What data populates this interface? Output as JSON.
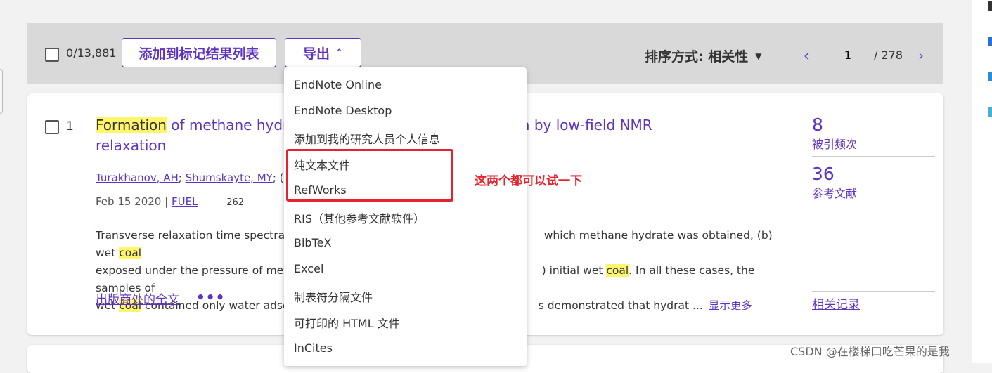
{
  "toolbar": {
    "selected_count": "0/13,881",
    "add_to_marked_label": "添加到标记结果列表",
    "export_label": "导出",
    "sort_label": "排序方式: 相关性",
    "page_current": "1",
    "page_total": "/ 278"
  },
  "result": {
    "number": "1",
    "title_highlight": "Formation",
    "title_part1": " of methane hydra",
    "title_part2": "n investgation by low-field NMR",
    "title_line2": "relaxation",
    "author1": "Turakhanov, AH",
    "author_sep": "; ",
    "author2": "Shumskayte, MY",
    "author_more": "; (...)",
    "date": "Feb 15 2020 |",
    "journal": "FUEL",
    "extra_num": "262",
    "abstract_l1a": "Transverse relaxation time spectra T-",
    "abstract_l1b": "which methane hydrate was obtained, (b) wet ",
    "abstract_l1c": "coal",
    "abstract_l2a": "exposed under the pressure of metha",
    "abstract_l2b": ") initial wet ",
    "abstract_l2c": "coal",
    "abstract_l2d": ". In all these cases, the samples of",
    "abstract_l3a": "wet ",
    "abstract_l3b": "coal",
    "abstract_l3c": " contained only water adsorb",
    "abstract_l3d": "s demonstrated that hydrat ...",
    "show_more": "显示更多",
    "full_text_label": "出版商处的全文",
    "more_dots": "•••",
    "times_cited": "8",
    "times_cited_label": "被引频次",
    "references": "36",
    "references_label": "参考文献",
    "related_label": "相关记录"
  },
  "export_menu": {
    "items": [
      "EndNote Online",
      "EndNote Desktop",
      "添加到我的研究人员个人信息",
      "纯文本文件",
      "RefWorks",
      "RIS（其他参考文献软件）",
      "BibTeX",
      "Excel",
      "制表符分隔文件",
      "可打印的 HTML 文件",
      "InCites"
    ]
  },
  "annotation": {
    "text": "这两个都可以试一下",
    "color": "#e8222b"
  },
  "watermark": "CSDN @在楼梯口吃芒果的是我",
  "colors": {
    "accent": "#5e33bf",
    "highlight": "#fff66b",
    "toolbar_bg": "#d9d9d9"
  }
}
